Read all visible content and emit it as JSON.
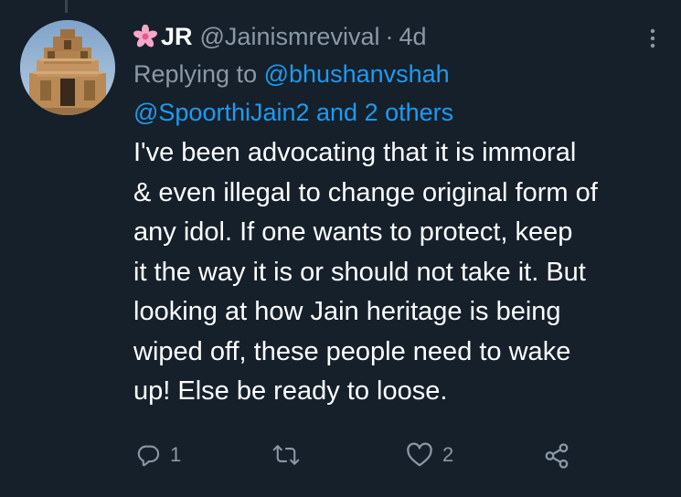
{
  "tweet": {
    "display_name": "JR",
    "handle": "@Jainismrevival",
    "separator": "·",
    "time": "4d",
    "reply_prefix": "Replying to",
    "mention_1": "@bhushanvshah",
    "mention_2": "@SpoorthiJain2 and 2 others",
    "lines": [
      "I've been advocating that it is immoral",
      "& even illegal to change original form of",
      "any idol. If one wants to protect, keep",
      "it the way it is or should not take it. But",
      "looking at how Jain heritage is being",
      "wiped off, these people need to wake",
      "up! Else be ready to loose."
    ]
  },
  "actions": {
    "reply_count": "1",
    "retweet_count": "",
    "like_count": "2"
  },
  "icons": {
    "reply": "reply-icon",
    "retweet": "retweet-icon",
    "like": "heart-icon",
    "share": "share-icon",
    "more": "more-vertical-icon",
    "name_emoji": "pink-flower-icon"
  },
  "colors": {
    "background": "#15202b",
    "accent": "#1d9bf0",
    "muted": "#8b98a5",
    "text": "#ffffff"
  }
}
